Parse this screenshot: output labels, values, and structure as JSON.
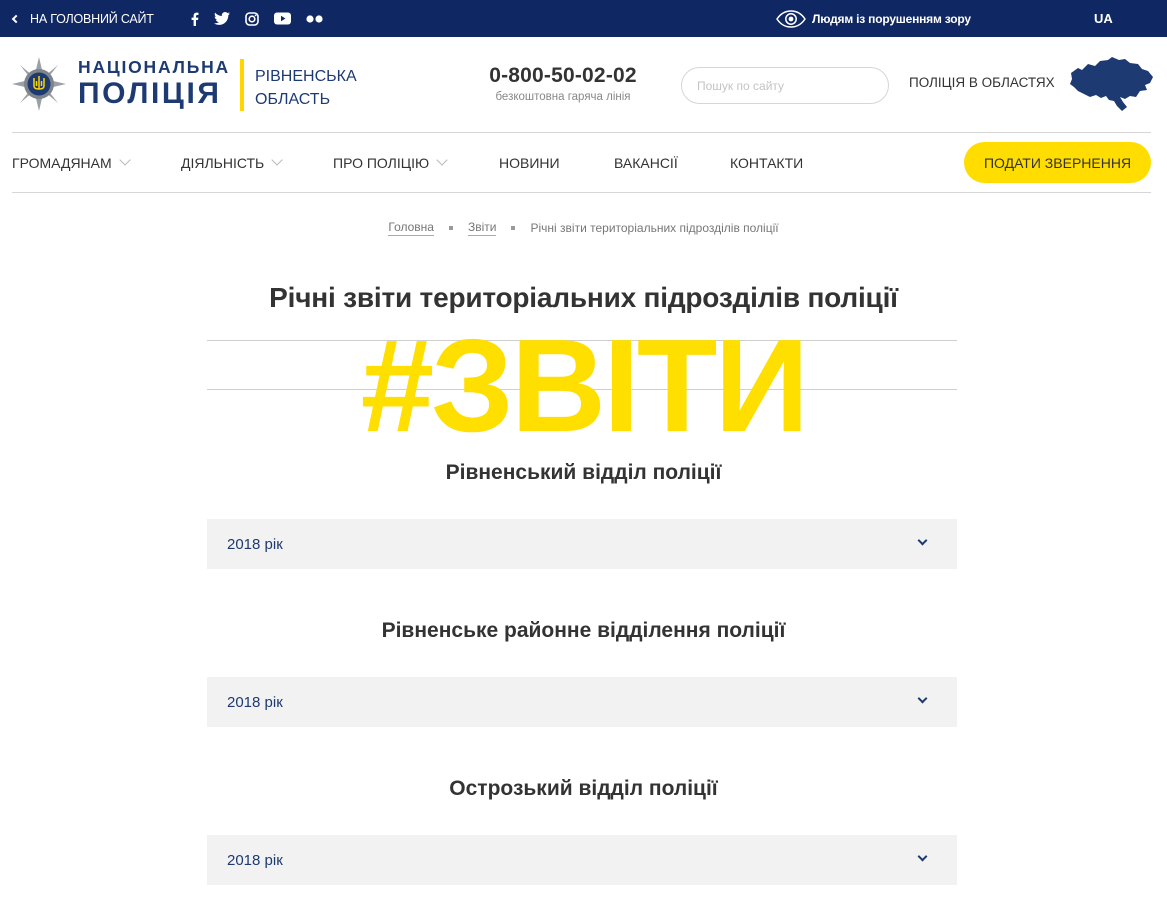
{
  "topbar": {
    "back_label": "НА ГОЛОВНИЙ САЙТ",
    "socials": [
      "facebook-icon",
      "twitter-icon",
      "instagram-icon",
      "youtube-icon",
      "flickr-icon"
    ],
    "vision_label": "Людям із порушенням зору",
    "language": "UA"
  },
  "header": {
    "logo_line1": "НАЦІОНАЛЬНА",
    "logo_line2": "ПОЛІЦІЯ",
    "region_line1": "РІВНЕНСЬКА",
    "region_line2": "ОБЛАСТЬ",
    "phone": "0-800-50-02-02",
    "phone_caption": "безкоштовна гаряча лінія",
    "search_placeholder": "Пошук по сайту",
    "regions_link": "ПОЛІЦІЯ В ОБЛАСТЯХ"
  },
  "nav": {
    "items": [
      "ГРОМАДЯНАМ",
      "ДІЯЛЬНІСТЬ",
      "ПРО ПОЛІЦІЮ",
      "НОВИНИ",
      "ВАКАНСІЇ",
      "КОНТАКТИ"
    ],
    "cta": "ПОДАТИ ЗВЕРНЕННЯ"
  },
  "breadcrumb": [
    "Головна",
    "Звіти",
    "Річні звіти територіальних підрозділів поліції"
  ],
  "page": {
    "title": "Річні звіти територіальних підрозділів поліції",
    "banner_text": "#ЗВІТИ"
  },
  "sections": [
    {
      "title": "Рівненський відділ поліції",
      "year": "2018 рік"
    },
    {
      "title": "Рівненське районне відділення поліції",
      "year": "2018 рік"
    },
    {
      "title": "Острозький відділ поліції",
      "year": "2018 рік"
    }
  ],
  "colors": {
    "topbar": "#0f2762",
    "brand_blue": "#1d3a72",
    "accent_yellow": "#ffdd00",
    "accordion_bg": "#f2f2f2"
  }
}
